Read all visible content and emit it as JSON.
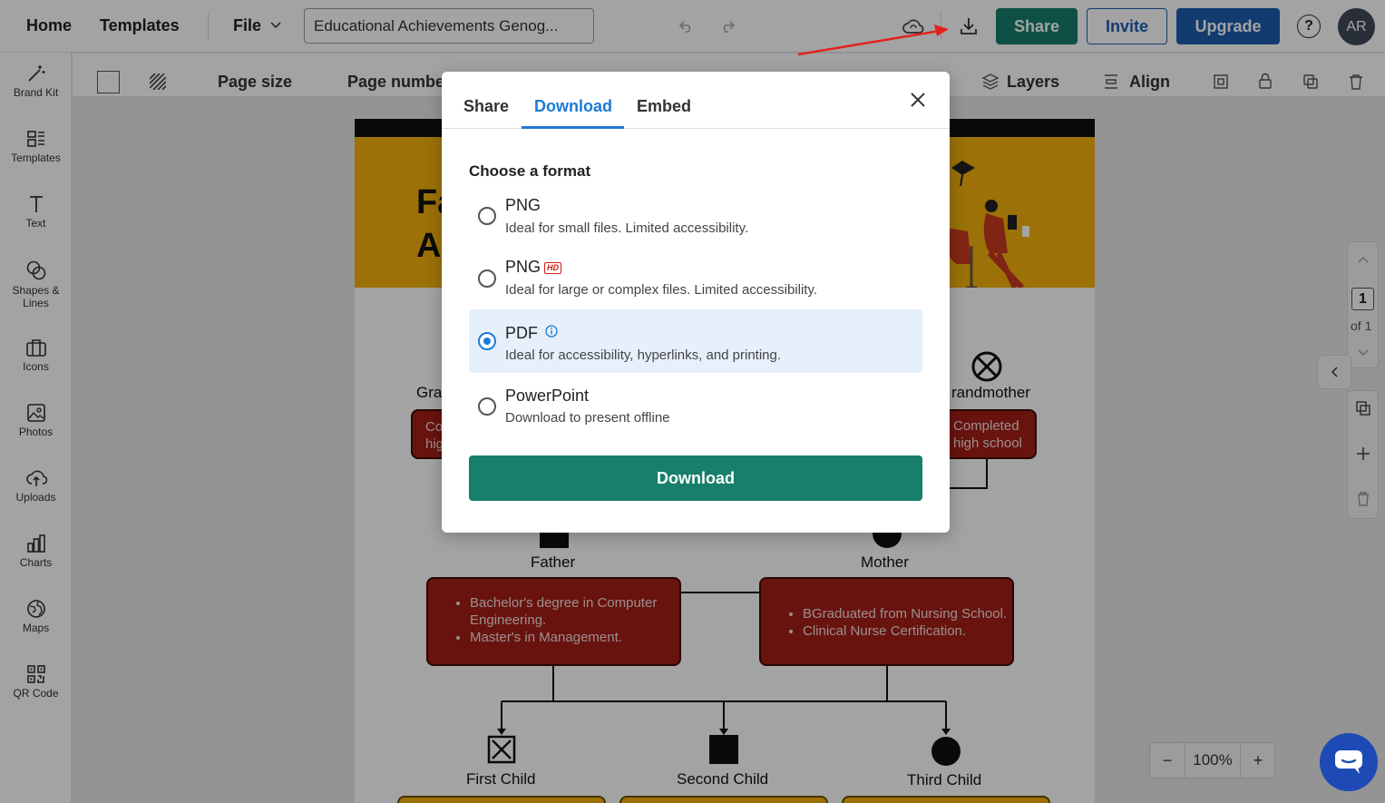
{
  "topbar": {
    "home": "Home",
    "templates": "Templates",
    "file": "File",
    "doc_title": "Educational Achievements Genog...",
    "share": "Share",
    "invite": "Invite",
    "upgrade": "Upgrade",
    "help": "?",
    "avatar": "AR"
  },
  "sidebar": {
    "items": [
      {
        "label": "Brand Kit",
        "icon": "wand-icon"
      },
      {
        "label": "Templates",
        "icon": "templates-icon"
      },
      {
        "label": "Text",
        "icon": "text-icon"
      },
      {
        "label": "Shapes &\nLines",
        "icon": "shapes-icon"
      },
      {
        "label": "Icons",
        "icon": "briefcase-icon"
      },
      {
        "label": "Photos",
        "icon": "photo-icon"
      },
      {
        "label": "Uploads",
        "icon": "upload-icon"
      },
      {
        "label": "Charts",
        "icon": "chart-icon"
      },
      {
        "label": "Maps",
        "icon": "globe-icon"
      },
      {
        "label": "QR Code",
        "icon": "qr-icon"
      }
    ]
  },
  "toolbar": {
    "page_size": "Page size",
    "page_number": "Page numbe",
    "layers": "Layers",
    "align": "Align"
  },
  "canvas": {
    "banner_title": "Fa\nAc",
    "grandparent_left": "Gra",
    "grandparent_right": "randmother",
    "left_box": "Co\nhig",
    "right_box_1": "Completed",
    "right_box_2": "high school",
    "father": "Father",
    "mother": "Mother",
    "father_items": [
      "Bachelor's degree in Computer Engineering.",
      "Master's in Management."
    ],
    "mother_items": [
      "BGraduated from Nursing School.",
      "Clinical Nurse Certification."
    ],
    "children": [
      "First Child",
      "Second Child",
      "Third Child"
    ]
  },
  "page_nav": {
    "current": "1",
    "of": "of 1"
  },
  "zoom": {
    "minus": "−",
    "value": "100%",
    "plus": "+"
  },
  "modal": {
    "tabs": [
      "Share",
      "Download",
      "Embed"
    ],
    "active_tab": "Download",
    "heading": "Choose a format",
    "options": [
      {
        "title": "PNG",
        "desc": "Ideal for small files. Limited accessibility.",
        "badge": "",
        "selected": false
      },
      {
        "title": "PNG",
        "desc": "Ideal for large or complex files. Limited accessibility.",
        "badge": "HD",
        "selected": false
      },
      {
        "title": "PDF",
        "desc": "Ideal for accessibility, hyperlinks, and printing.",
        "badge": "",
        "selected": true
      },
      {
        "title": "PowerPoint",
        "desc": "Download to present offline",
        "badge": "",
        "selected": false
      }
    ],
    "download_button": "Download"
  },
  "colors": {
    "accent": "#1c7ad6",
    "share_green": "#177f6b",
    "upgrade_blue": "#1d5fb0",
    "banner_yellow": "#f2b10d",
    "box_red": "#a31f16",
    "annotation_arrow": "#e3211c"
  }
}
